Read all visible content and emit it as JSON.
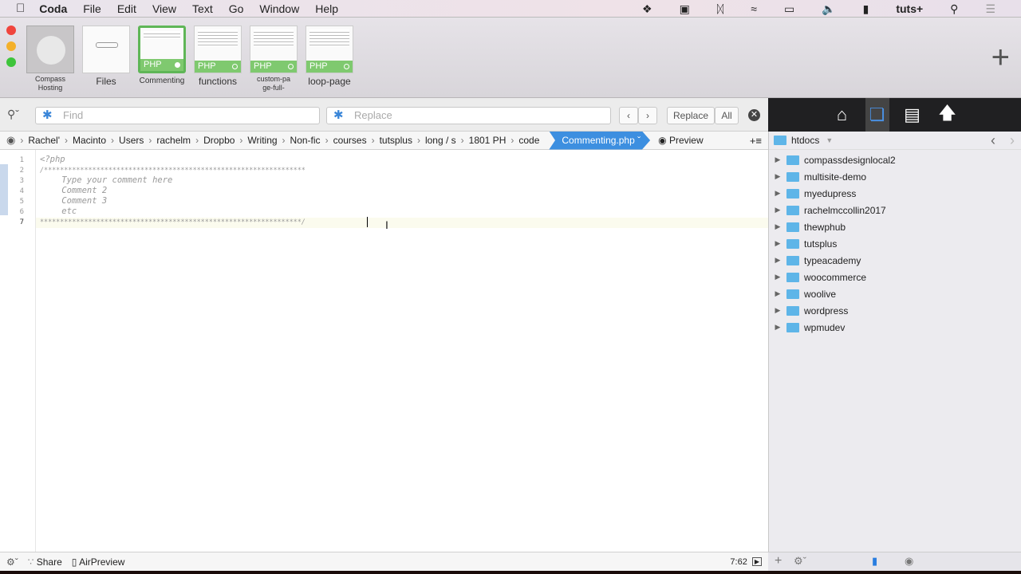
{
  "menubar": {
    "app": "Coda",
    "items": [
      "File",
      "Edit",
      "View",
      "Text",
      "Go",
      "Window",
      "Help"
    ],
    "user": "tuts+"
  },
  "sites": [
    {
      "label": "Compass Hosting",
      "type": "globe"
    },
    {
      "label": "Files",
      "type": "files"
    },
    {
      "label": "Commenting",
      "badge": "PHP",
      "active": true
    },
    {
      "label": "functions",
      "badge": "PHP"
    },
    {
      "label": "custom-page-full-",
      "badge": "PHP"
    },
    {
      "label": "loop-page",
      "badge": "PHP"
    }
  ],
  "find": {
    "find_placeholder": "Find",
    "replace_placeholder": "Replace",
    "replace_label": "Replace",
    "all_label": "All"
  },
  "breadcrumb": [
    "Rachel'",
    "Macinto",
    "Users",
    "rachelm",
    "Dropbo",
    "Writing",
    "Non-fic",
    "courses",
    "tutsplus",
    "long / s",
    "1801 PH",
    "code"
  ],
  "current_file": "Commenting.php",
  "preview_label": "Preview",
  "editor": {
    "lines": [
      "<?php",
      "/*****************************************************************",
      "    Type your comment here",
      "    Comment 2",
      "    Comment 3",
      "    etc",
      "*****************************************************************/"
    ],
    "current_line": 7
  },
  "statusbar": {
    "share": "Share",
    "airpreview": "AirPreview",
    "position": "7:62"
  },
  "sidebar": {
    "folder": "htdocs",
    "items": [
      "compassdesignlocal2",
      "multisite-demo",
      "myedupress",
      "rachelmccollin2017",
      "thewphub",
      "tutsplus",
      "typeacademy",
      "woocommerce",
      "woolive",
      "wordpress",
      "wpmudev"
    ]
  },
  "colors": {
    "accent": "#3d8fe0",
    "php_badge": "#7fc96f",
    "folder": "#5eb5e8"
  }
}
